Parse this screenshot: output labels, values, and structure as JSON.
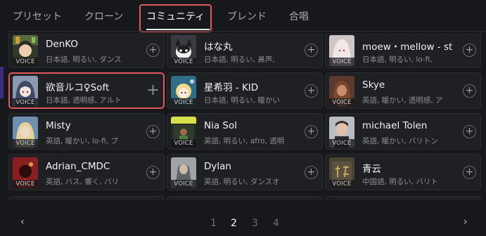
{
  "tabs": [
    {
      "label": "プリセット",
      "active": false
    },
    {
      "label": "クローン",
      "active": false
    },
    {
      "label": "コミュニティ",
      "active": true
    },
    {
      "label": "ブレンド",
      "active": false
    },
    {
      "label": "合唱",
      "active": false
    }
  ],
  "voice_badge": "VOICE",
  "add_symbol": "+",
  "cards": [
    {
      "name": "DenKO",
      "tags": "日本語, 明るい, ダンス"
    },
    {
      "name": "はな丸",
      "tags": "日本語, 明るい, 鼻声, "
    },
    {
      "name": "moew・mellow - st",
      "tags": "日本語, 明るい, lo-fi, "
    },
    {
      "name": "欲音ルコ♀Soft",
      "tags": "日本語, 透明感, アルト"
    },
    {
      "name": "星希羽 - KID",
      "tags": "日本語, 明るい, 暖かい"
    },
    {
      "name": "Skye",
      "tags": "英語, 暖かい, 透明感, ア"
    },
    {
      "name": "Misty",
      "tags": "英語, 暖かい, lo-fi, プ"
    },
    {
      "name": "Nia Sol",
      "tags": "英語, 明るい, afro, 透明"
    },
    {
      "name": "michael Tolen",
      "tags": "英語, 暖かい, バリトン"
    },
    {
      "name": "Adrian_CMDC",
      "tags": "英語, バス, 響く, バリ"
    },
    {
      "name": "Dylan",
      "tags": "英語, 明るい, ダンスオ"
    },
    {
      "name": "青云",
      "tags": "中国語, 明るい, バリト"
    }
  ],
  "pagination": {
    "prev": "‹",
    "next": "›",
    "pages": [
      "1",
      "2",
      "3",
      "4"
    ],
    "current": "2"
  }
}
